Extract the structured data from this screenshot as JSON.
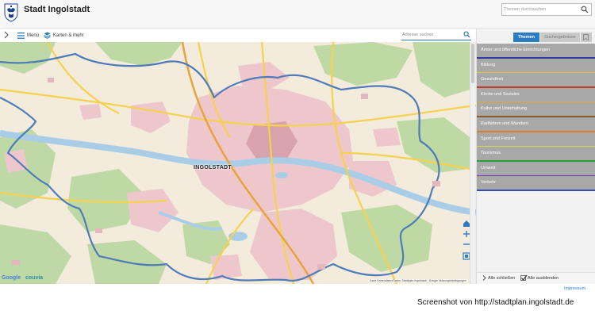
{
  "header": {
    "title": "Stadt Ingolstadt",
    "topic_search_placeholder": "Themen durchsuchen"
  },
  "toolbar": {
    "menu_label": "Menü",
    "maps_label": "Karten & mehr",
    "address_search_placeholder": "Adresse suchen"
  },
  "map": {
    "city_label": "INGOLSTADT",
    "google_logo": "Google",
    "couvia_logo": "couvia",
    "attribution": "Karte Kartendaten/Daten: Stadtplan Ingolstadt · Google Nutzungsbedingungen",
    "colors": {
      "background": "#f3ecdd",
      "urban": "#eec7cd",
      "forest": "#b9d79f",
      "water": "#a9cde6",
      "boundary": "#4f7cb8",
      "major_road": "#f4d24e"
    }
  },
  "panel": {
    "tabs": [
      {
        "label": "Themen",
        "active": true
      },
      {
        "label": "Suchergebnisse",
        "active": false
      },
      {
        "icon": "bookmark-icon"
      }
    ],
    "categories": [
      {
        "label": "Ämter und öffentliche Einrichtungen",
        "color": "#2f3d9c"
      },
      {
        "label": "Bildung",
        "color": "#e0c63a"
      },
      {
        "label": "Gesundheit",
        "color": "#c0392b"
      },
      {
        "label": "Kirche und Soziales",
        "color": "#e0a83a"
      },
      {
        "label": "Kultur und Unterhaltung",
        "color": "#8a5a2b"
      },
      {
        "label": "Radfahren und Wandern",
        "color": "#e07b2a"
      },
      {
        "label": "Sport und Freizeit",
        "color": "#d4d84a"
      },
      {
        "label": "Tourismus",
        "color": "#2a9c3a"
      },
      {
        "label": "Umwelt",
        "color": "#7a3bb8"
      },
      {
        "label": "Verkehr",
        "color": "#3b4cb8"
      }
    ],
    "footer": {
      "close_all_label": "Alle schließen",
      "hide_all_label": "Alle ausblenden",
      "hide_all_checked": true
    }
  },
  "impressum": "Impressum",
  "caption": "Screenshot von http://stadtplan.ingolstadt.de"
}
